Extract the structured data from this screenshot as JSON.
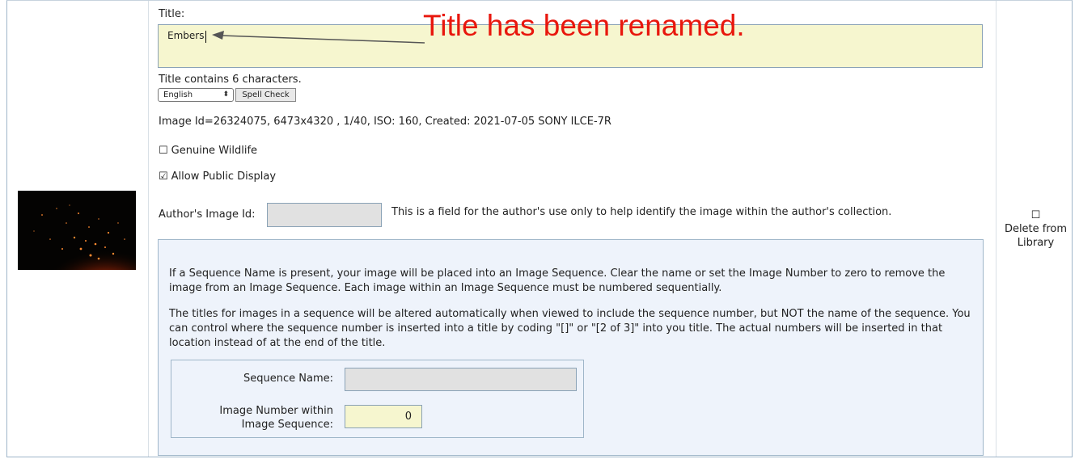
{
  "title_field": {
    "label": "Title:",
    "value": "Embers",
    "annotation": "Title has been renamed.",
    "char_count_text": "Title contains 6 characters."
  },
  "spell": {
    "language_selected": "English",
    "button_label": "Spell Check"
  },
  "image_info": "Image Id=26324075, 6473x4320 , 1/40, ISO: 160, Created: 2021-07-05 SONY ILCE-7R",
  "checkboxes": {
    "genuine_wildlife": {
      "label": "Genuine Wildlife",
      "checked": false,
      "glyph": "☐"
    },
    "allow_public": {
      "label": "Allow Public Display",
      "checked": true,
      "glyph": "☑"
    }
  },
  "author_image_id": {
    "label": "Author's Image Id:",
    "value": "",
    "help": "This is a field for the author's use only to help identify the image within the author's collection."
  },
  "sequence": {
    "para1": "If a Sequence Name is present, your image will be placed into an Image Sequence. Clear the name or set the Image Number to zero to remove the image from an Image Sequence. Each image within an Image Sequence must be numbered sequentially.",
    "para2": "The titles for images in a sequence will be altered automatically when viewed to include the sequence number, but NOT the name of the sequence. You can control where the sequence number is inserted into a title by coding \"[]\" or \"[2 of 3]\" into you title. The actual numbers will be inserted in that location instead of at the end of the title.",
    "name_label": "Sequence Name:",
    "name_value": "",
    "number_label_line1": "Image Number within",
    "number_label_line2": "Image Sequence:",
    "number_value": "0"
  },
  "delete": {
    "glyph": "☐",
    "line1": "Delete from",
    "line2": "Library"
  },
  "colors": {
    "annotation_red": "#e8170d",
    "title_field_bg": "#f6f6cf",
    "sequence_panel_bg": "#eef3fb"
  }
}
